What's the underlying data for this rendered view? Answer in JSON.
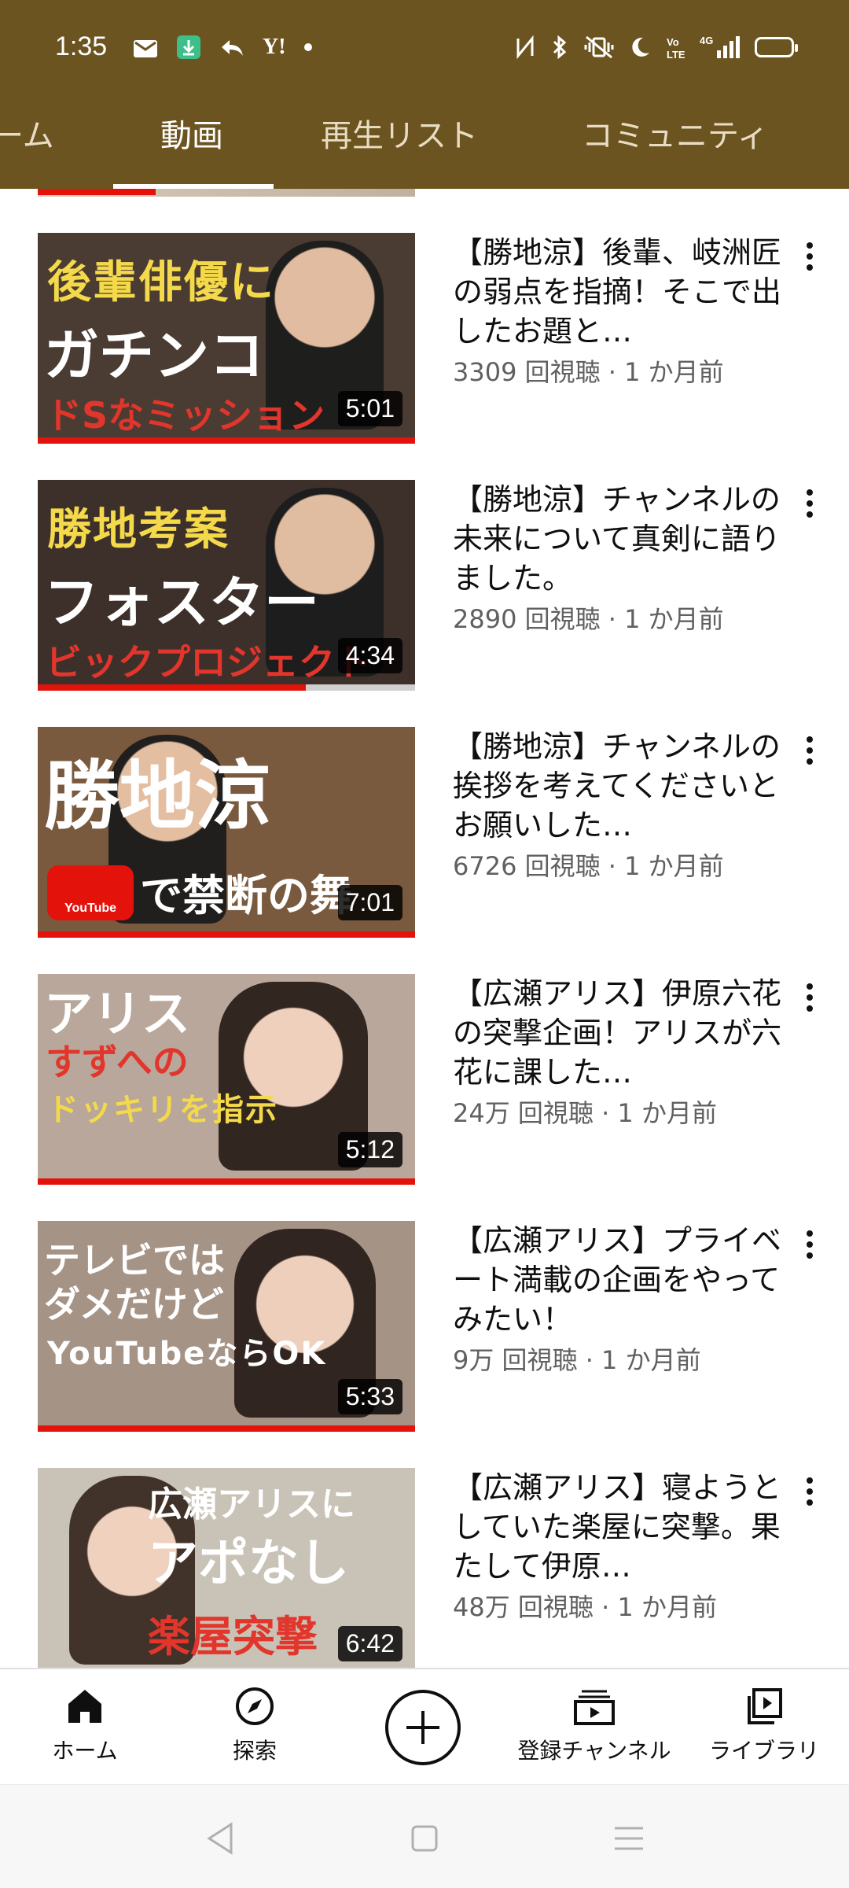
{
  "status_bar": {
    "time": "1:35",
    "left_icons": [
      "mail-icon",
      "download-icon",
      "reply-icon",
      "yahoo-icon",
      "dot-icon"
    ],
    "yahoo_label": "Y!",
    "right_icons": [
      "nfc-icon",
      "bluetooth-icon",
      "vibrate-icon",
      "moon-icon",
      "volte-icon",
      "signal-icon",
      "battery-icon"
    ],
    "network": "4G"
  },
  "tabs": [
    {
      "label": "ーム",
      "active": false
    },
    {
      "label": "動画",
      "active": true
    },
    {
      "label": "再生リスト",
      "active": false
    },
    {
      "label": "コミュニティ",
      "active": false
    }
  ],
  "videos": [
    {
      "title": "【勝地涼】後輩、岐洲匠の弱点を指摘！そこで出したお題と…",
      "meta": "3309 回視聴 · 1 か月前",
      "duration": "5:01",
      "progress": 1.0,
      "thumb_lines": [
        "後輩俳優に",
        "ガチンコ",
        "ドSなミッション"
      ],
      "thumb_bg": "#4a3b33"
    },
    {
      "title": "【勝地涼】チャンネルの未来について真剣に語りました。",
      "meta": "2890 回視聴 · 1 か月前",
      "duration": "4:34",
      "progress": 0.71,
      "thumb_lines": [
        "勝地考案",
        "フォスター",
        "ビックプロジェクト"
      ],
      "thumb_bg": "#3d302b"
    },
    {
      "title": "【勝地涼】チャンネルの挨拶を考えてくださいとお願いした…",
      "meta": "6726 回視聴 · 1 か月前",
      "duration": "7:01",
      "progress": 1.0,
      "thumb_lines": [
        "勝地涼",
        "で禁断の舞",
        "YouTube"
      ],
      "thumb_bg": "#7a5a3e"
    },
    {
      "title": "【広瀬アリス】伊原六花の突撃企画！アリスが六花に課した…",
      "meta": "24万 回視聴 · 1 か月前",
      "duration": "5:12",
      "progress": 1.0,
      "thumb_lines": [
        "アリス",
        "すずへの",
        "ドッキリを指示"
      ],
      "thumb_bg": "#b8a79a"
    },
    {
      "title": "【広瀬アリス】プライベート満載の企画をやってみたい！",
      "meta": "9万 回視聴 · 1 か月前",
      "duration": "5:33",
      "progress": 1.0,
      "thumb_lines": [
        "テレビでは",
        "ダメだけど",
        "YouTubeならOK"
      ],
      "thumb_bg": "#a59386"
    },
    {
      "title": "【広瀬アリス】寝ようとしていた楽屋に突撃。果たして伊原…",
      "meta": "48万 回視聴 · 1 か月前",
      "duration": "6:42",
      "progress": 1.0,
      "thumb_lines": [
        "広瀬アリスに",
        "アポなし",
        "楽屋突撃"
      ],
      "thumb_bg": "#c9c2b6"
    }
  ],
  "bottom_nav": {
    "home": "ホーム",
    "explore": "探索",
    "subscriptions": "登録チャンネル",
    "library": "ライブラリ"
  },
  "colors": {
    "header": "#6b5420",
    "accent_red": "#e3120b",
    "tab_active": "#ffffff",
    "tab_inactive": "#e8ddc4"
  }
}
